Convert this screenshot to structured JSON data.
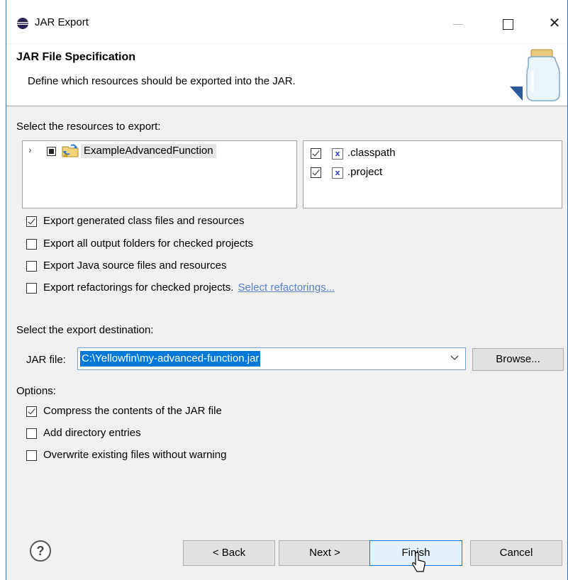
{
  "window": {
    "title": "JAR Export",
    "controls": {
      "minimize_icon": "minimize-icon",
      "maximize_icon": "maximize-icon",
      "close_glyph": "✕"
    }
  },
  "banner": {
    "title": "JAR File Specification",
    "description": "Define which resources should be exported into the JAR.",
    "icon": "jar-icon"
  },
  "resources": {
    "label": "Select the resources to export:",
    "tree": [
      {
        "label": "ExampleAdvancedFunction",
        "expanded": false,
        "check_state": "partial",
        "icon": "java-project-icon"
      }
    ],
    "files": [
      {
        "label": ".classpath",
        "checked": true,
        "icon": "xml-file-icon"
      },
      {
        "label": ".project",
        "checked": true,
        "icon": "xml-file-icon"
      }
    ]
  },
  "export_options": [
    {
      "label": "Export generated class files and resources",
      "checked": true
    },
    {
      "label": "Export all output folders for checked projects",
      "checked": false
    },
    {
      "label": "Export Java source files and resources",
      "checked": false
    },
    {
      "label": "Export refactorings for checked projects.",
      "checked": false,
      "link": "Select refactorings..."
    }
  ],
  "destination": {
    "label": "Select the export destination:",
    "jar_file_label": "JAR file:",
    "jar_file_value": "C:\\Yellowfin\\my-advanced-function.jar",
    "browse_label": "Browse..."
  },
  "options": {
    "label": "Options:",
    "items": [
      {
        "label": "Compress the contents of the JAR file",
        "checked": true
      },
      {
        "label": "Add directory entries",
        "checked": false
      },
      {
        "label": "Overwrite existing files without warning",
        "checked": false
      }
    ]
  },
  "footer": {
    "help_glyph": "?",
    "back_label": "< Back",
    "next_label": "Next >",
    "finish_label": "Finish",
    "cancel_label": "Cancel",
    "default_button": "finish"
  },
  "colors": {
    "selection": "#0078d7",
    "link": "#5a82c8",
    "dialog_bg": "#f0f0f0",
    "window_border": "#3a6ea5"
  }
}
